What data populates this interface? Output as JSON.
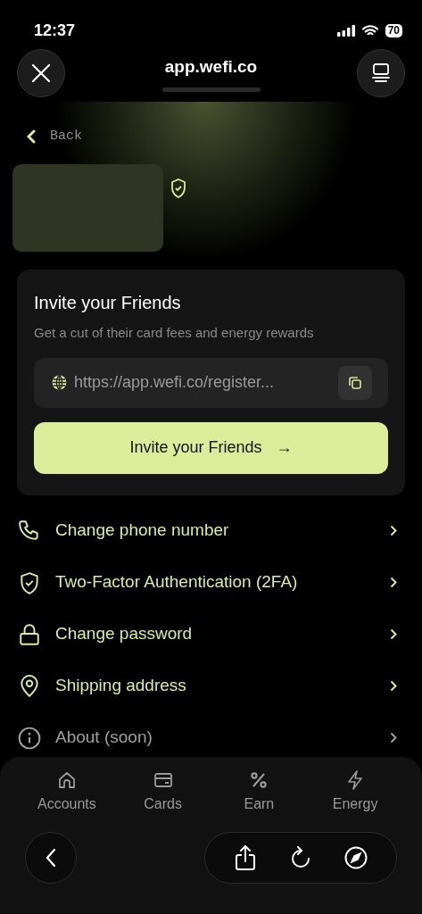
{
  "status_bar": {
    "time": "12:37",
    "battery": "70"
  },
  "browser": {
    "address": "app.wefi.co"
  },
  "back": {
    "label": "Back"
  },
  "invite_card": {
    "title": "Invite your Friends",
    "subtitle": "Get a cut of their card fees and energy rewards",
    "link": "https://app.wefi.co/register...",
    "button": "Invite your Friends",
    "button_arrow": "→"
  },
  "menu": [
    {
      "label": "Change phone number",
      "disabled": false
    },
    {
      "label": "Two-Factor Authentication (2FA)",
      "disabled": false
    },
    {
      "label": "Change password",
      "disabled": false
    },
    {
      "label": "Shipping address",
      "disabled": false
    },
    {
      "label": "About (soon)",
      "disabled": true
    }
  ],
  "tabs": [
    {
      "label": "Accounts"
    },
    {
      "label": "Cards"
    },
    {
      "label": "Earn"
    },
    {
      "label": "Energy"
    }
  ]
}
